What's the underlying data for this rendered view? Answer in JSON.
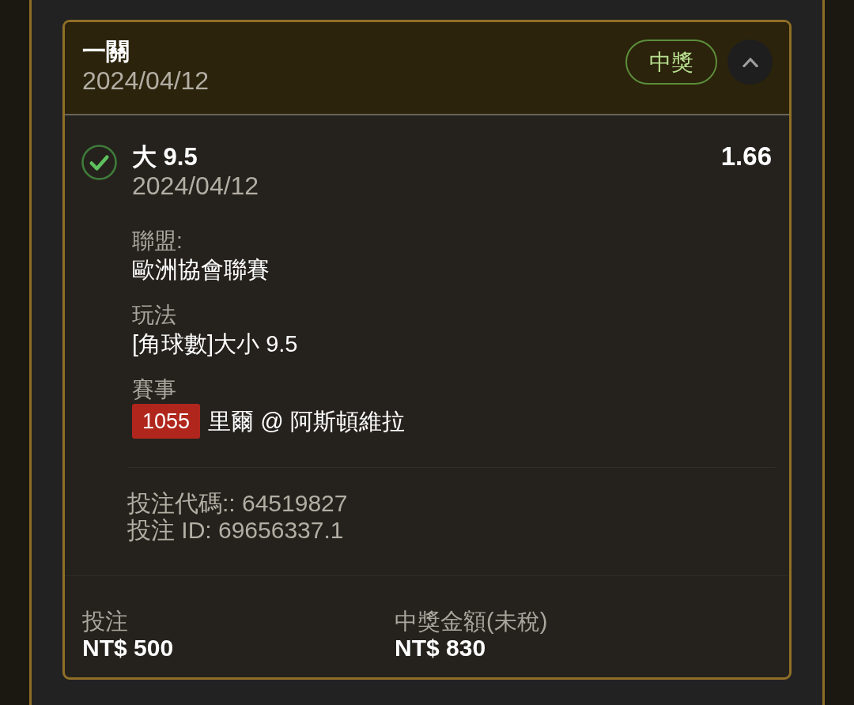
{
  "ticket": {
    "title": "一關",
    "date": "2024/04/12",
    "status_badge": "中獎",
    "expanded": true
  },
  "selection": {
    "won": true,
    "pick": "大 9.5",
    "odds": "1.66",
    "date": "2024/04/12",
    "details": [
      {
        "kind": "text",
        "label": "聯盟:",
        "value": "歐洲協會聯賽"
      },
      {
        "kind": "text",
        "label": "玩法",
        "value": "[角球數]大小 9.5"
      },
      {
        "kind": "match",
        "label": "賽事",
        "match_number": "1055",
        "value": "里爾 @ 阿斯頓維拉"
      }
    ]
  },
  "bet_codes": [
    "投注代碼:: 64519827",
    "投注 ID: 69656337.1"
  ],
  "summary": [
    {
      "label": "投注",
      "amount": "NT$ 500"
    },
    {
      "label": "中獎金額(未稅)",
      "amount": "NT$ 830"
    }
  ]
}
